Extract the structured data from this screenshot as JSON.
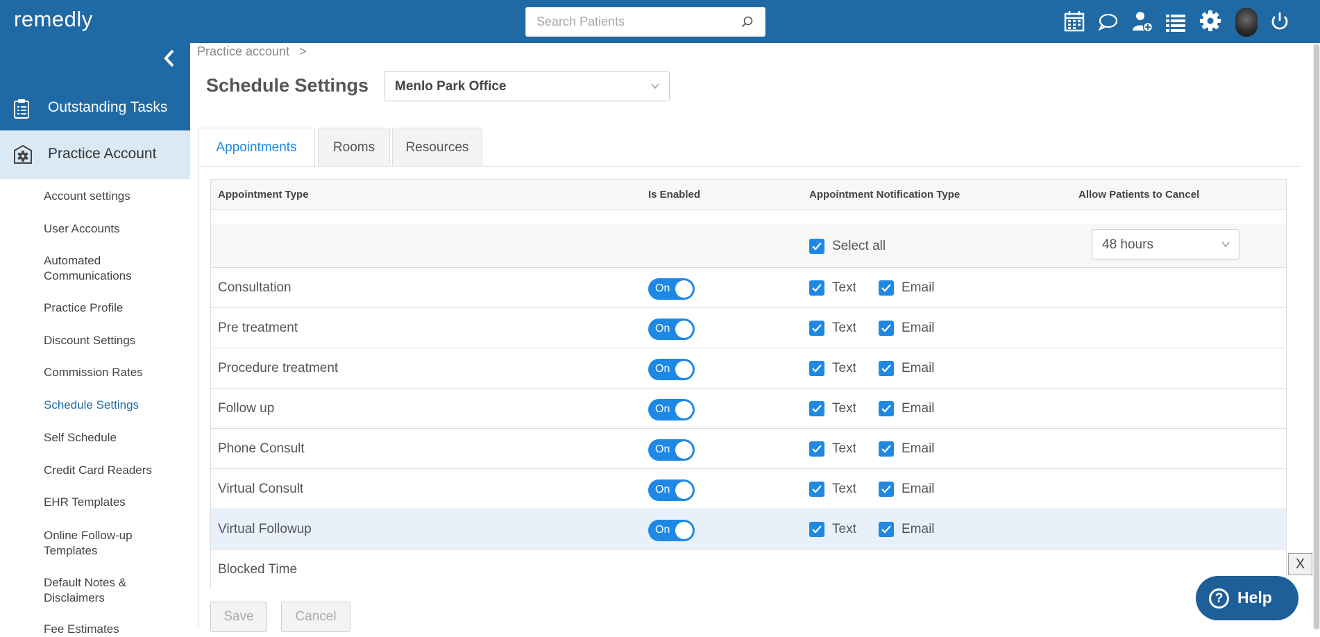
{
  "app": {
    "logo_text": "remedly",
    "logo_accent_color": "#3fd08a",
    "brand_color": "#1f6aa5"
  },
  "header": {
    "search": {
      "placeholder": "Search Patients"
    },
    "icons": [
      "calendar-icon",
      "chat-icon",
      "add-user-icon",
      "list-icon",
      "settings-icon",
      "avatar",
      "power-icon"
    ]
  },
  "sidebar": {
    "outstanding_tasks": "Outstanding Tasks",
    "practice_account": "Practice Account",
    "items": [
      "Account settings",
      "User Accounts",
      "Automated Communications",
      "Practice Profile",
      "Discount Settings",
      "Commission Rates",
      "Schedule Settings",
      "Self Schedule",
      "Credit Card Readers",
      "EHR Templates",
      "Online Follow-up Templates",
      "Default Notes & Disclaimers",
      "Fee Estimates"
    ],
    "active_item": "Schedule Settings"
  },
  "breadcrumb": {
    "parent": "Practice account",
    "separator": ">"
  },
  "page": {
    "title": "Schedule Settings",
    "office_select": "Menlo Park Office"
  },
  "tabs": [
    {
      "label": "Appointments",
      "active": true
    },
    {
      "label": "Rooms",
      "active": false
    },
    {
      "label": "Resources",
      "active": false
    }
  ],
  "table": {
    "headers": {
      "type": "Appointment Type",
      "enabled": "Is Enabled",
      "notification": "Appointment Notification Type",
      "cancel": "Allow Patients to Cancel"
    },
    "select_all_label": "Select all",
    "select_all_checked": true,
    "cancel_window": "48 hours",
    "toggle_on_label": "On",
    "text_label": "Text",
    "email_label": "Email",
    "rows": [
      {
        "name": "Consultation",
        "enabled": true,
        "text": true,
        "email": true
      },
      {
        "name": "Pre treatment",
        "enabled": true,
        "text": true,
        "email": true
      },
      {
        "name": "Procedure treatment",
        "enabled": true,
        "text": true,
        "email": true
      },
      {
        "name": "Follow up",
        "enabled": true,
        "text": true,
        "email": true
      },
      {
        "name": "Phone Consult",
        "enabled": true,
        "text": true,
        "email": true
      },
      {
        "name": "Virtual Consult",
        "enabled": true,
        "text": true,
        "email": true
      },
      {
        "name": "Virtual Followup",
        "enabled": true,
        "text": true,
        "email": true,
        "highlighted": true
      },
      {
        "name": "Blocked Time"
      }
    ]
  },
  "actions": {
    "save": "Save",
    "cancel": "Cancel"
  },
  "help": {
    "label": "Help",
    "close": "X"
  }
}
